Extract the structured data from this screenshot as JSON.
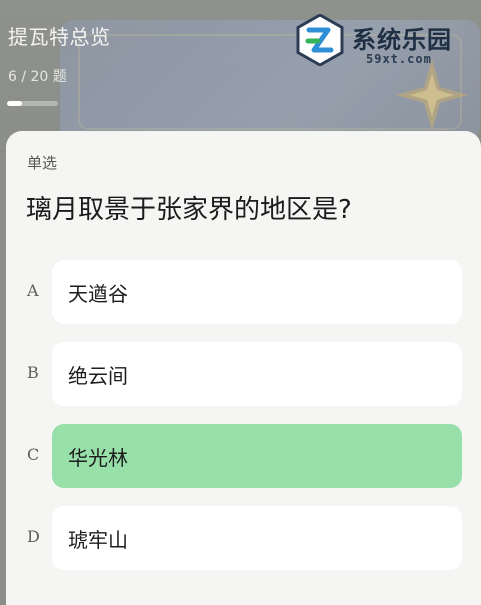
{
  "header": {
    "title": "提瓦特总览",
    "progress_text": "6 / 20 题",
    "progress_fraction": 0.3
  },
  "watermark": {
    "brand": "系统乐园",
    "domain": "59xt.com"
  },
  "question": {
    "type_label": "单选",
    "text": "璃月取景于张家界的地区是?"
  },
  "options": [
    {
      "letter": "A",
      "label": "天遒谷",
      "selected": false
    },
    {
      "letter": "B",
      "label": "绝云间",
      "selected": false
    },
    {
      "letter": "C",
      "label": "华光林",
      "selected": true
    },
    {
      "letter": "D",
      "label": "琥牢山",
      "selected": false
    }
  ],
  "colors": {
    "selected_option": "#98e0a9",
    "option_background": "#ffffff",
    "card_background": "#f5f6f3"
  }
}
